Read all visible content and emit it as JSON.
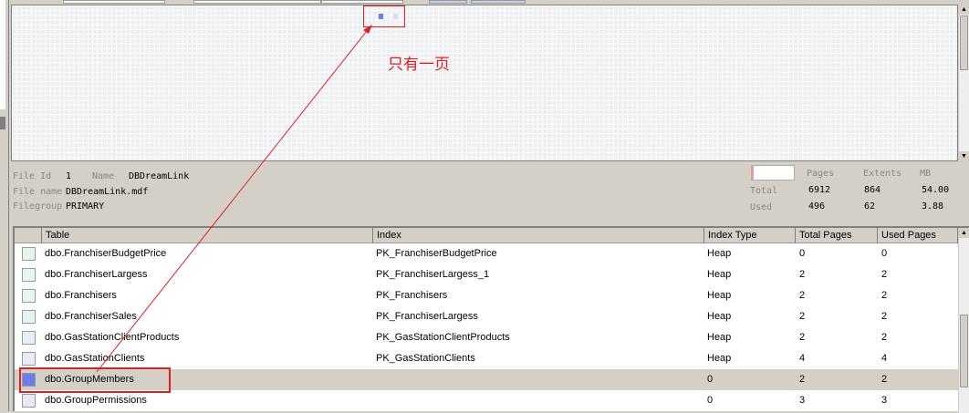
{
  "annotation": "只有一页",
  "file": {
    "id_label": "File Id",
    "id": "1",
    "name_label": "Name",
    "name": "DBDreamLink",
    "filename_label": "File name",
    "filename": "DBDreamLink.mdf",
    "filegroup_label": "Filegroup",
    "filegroup": "PRIMARY"
  },
  "stats": {
    "headers": [
      "Pages",
      "Extents",
      "MB"
    ],
    "total_label": "Total",
    "total": [
      "6912",
      "864",
      "54.00"
    ],
    "used_label": "Used",
    "used": [
      "496",
      "62",
      "3.88"
    ]
  },
  "columns": [
    "Table",
    "Index",
    "Index Type",
    "Total Pages",
    "Used Pages"
  ],
  "rows": [
    {
      "table": "dbo.FranchiserBudgetPrice",
      "index": "PK_FranchiserBudgetPrice",
      "type": "Heap",
      "total": "0",
      "used": "0",
      "color": "#e6f5ea"
    },
    {
      "table": "dbo.FranchiserLargess",
      "index": "PK_FranchiserLargess_1",
      "type": "Heap",
      "total": "2",
      "used": "2",
      "color": "#e6f7ee"
    },
    {
      "table": "dbo.Franchisers",
      "index": "PK_Franchisers",
      "type": "Heap",
      "total": "2",
      "used": "2",
      "color": "#e4f7f2"
    },
    {
      "table": "dbo.FranchiserSales",
      "index": "PK_FranchiserLargess",
      "type": "Heap",
      "total": "2",
      "used": "2",
      "color": "#e4f4f6"
    },
    {
      "table": "dbo.GasStationClientProducts",
      "index": "PK_GasStationClientProducts",
      "type": "Heap",
      "total": "2",
      "used": "2",
      "color": "#e6eff8"
    },
    {
      "table": "dbo.GasStationClients",
      "index": "PK_GasStationClients",
      "type": "Heap",
      "total": "4",
      "used": "4",
      "color": "#e8eaf8"
    },
    {
      "table": "dbo.GroupMembers",
      "index": "",
      "type": "0",
      "total": "2",
      "used": "2",
      "color": "#6a7ee8"
    },
    {
      "table": "dbo.GroupPermissions",
      "index": "",
      "type": "0",
      "total": "3",
      "used": "3",
      "color": "#ebe6f8"
    }
  ]
}
